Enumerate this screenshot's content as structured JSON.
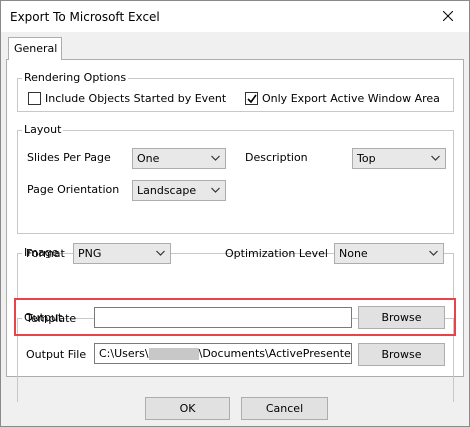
{
  "window": {
    "title": "Export To Microsoft Excel"
  },
  "tabs": [
    {
      "label": "General"
    }
  ],
  "rendering": {
    "title": "Rendering Options",
    "include_objects": {
      "label": "Include Objects Started by Event",
      "checked": false
    },
    "only_active_window": {
      "label": "Only Export Active Window Area",
      "checked": true
    }
  },
  "layout": {
    "title": "Layout",
    "slides_per_page": {
      "label": "Slides Per Page",
      "value": "One"
    },
    "description": {
      "label": "Description",
      "value": "Top"
    },
    "page_orientation": {
      "label": "Page Orientation",
      "value": "Landscape"
    }
  },
  "image": {
    "title": "Image",
    "format": {
      "label": "Format",
      "value": "PNG"
    },
    "optimization": {
      "label": "Optimization Level",
      "value": "None"
    }
  },
  "output": {
    "title": "Output",
    "template": {
      "label": "Template",
      "value": "",
      "browse_label": "Browse"
    },
    "output_file": {
      "label": "Output File",
      "prefix": "C:\\Users\\",
      "suffix": "\\Documents\\ActivePresenter",
      "browse_label": "Browse"
    }
  },
  "footer": {
    "ok_label": "OK",
    "cancel_label": "Cancel"
  },
  "colors": {
    "highlight": "#e8424a"
  }
}
